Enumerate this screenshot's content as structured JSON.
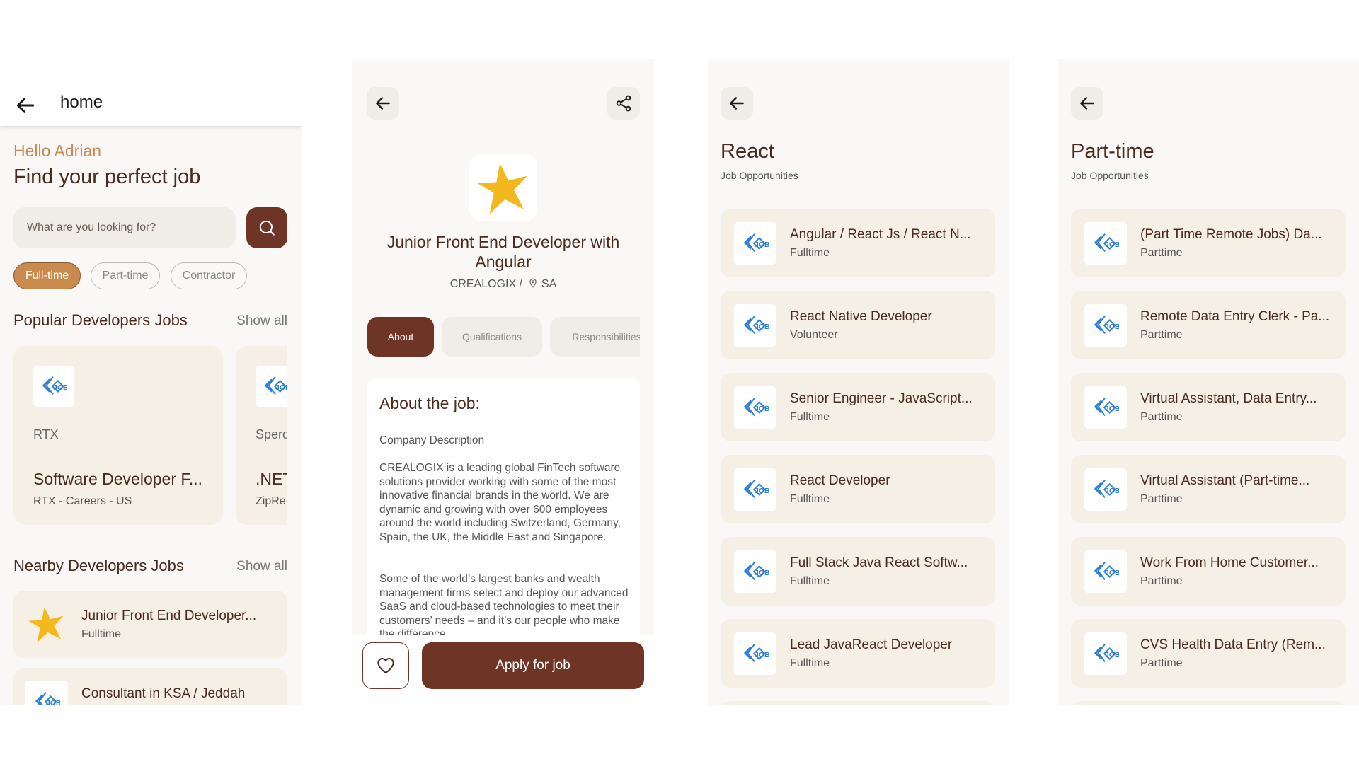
{
  "screen_home": {
    "appbar_title": "home",
    "greeting": "Hello Adrian",
    "headline": "Find your perfect job",
    "search_placeholder": "What are you looking for?",
    "chips": [
      "Full-time",
      "Part-time",
      "Contractor"
    ],
    "popular": {
      "heading": "Popular Developers Jobs",
      "show_all": "Show all",
      "cards": [
        {
          "company": "RTX",
          "title": "Software Developer F...",
          "subtitle": "RTX - Careers - US"
        },
        {
          "company": "Sperc",
          "title": ".NET",
          "subtitle": "ZipRe"
        }
      ]
    },
    "nearby": {
      "heading": "Nearby Developers Jobs",
      "show_all": "Show all",
      "items": [
        {
          "title": "Junior Front End Developer...",
          "type": "Fulltime"
        },
        {
          "title": "Consultant in KSA / Jeddah",
          "type": ""
        }
      ]
    }
  },
  "screen_detail": {
    "job_title": "Junior Front End Developer with Angular",
    "company": "CREALOGIX /",
    "location": "SA",
    "tabs": [
      "About",
      "Qualifications",
      "Responsibilities"
    ],
    "about_heading": "About the job:",
    "paragraphs": [
      "Company Description",
      "CREALOGIX is a leading global FinTech software solutions provider working with some of the most innovative financial brands in the world. We are dynamic and growing with over 600 employees around the world including Switzerland, Germany, Spain, the UK, the Middle East and Singapore.",
      "Some of the world’s largest banks and wealth management firms select and deploy our advanced SaaS and cloud-based technologies to meet their customers’ needs – and it’s our people who make the difference."
    ],
    "apply_label": "Apply for job"
  },
  "screen_react": {
    "heading": "React",
    "subheading": "Job Opportunities",
    "jobs": [
      {
        "title": "Angular / React Js / React N...",
        "type": "Fulltime"
      },
      {
        "title": "React Native Developer",
        "type": "Volunteer"
      },
      {
        "title": "Senior Engineer - JavaScript...",
        "type": "Fulltime"
      },
      {
        "title": "React Developer",
        "type": "Fulltime"
      },
      {
        "title": "Full Stack Java React Softw...",
        "type": "Fulltime"
      },
      {
        "title": "Lead JavaReact Developer",
        "type": "Fulltime"
      }
    ]
  },
  "screen_parttime": {
    "heading": "Part-time",
    "subheading": "Job Opportunities",
    "jobs": [
      {
        "title": "(Part Time Remote Jobs) Da...",
        "type": "Parttime"
      },
      {
        "title": "Remote Data Entry Clerk - Pa...",
        "type": "Parttime"
      },
      {
        "title": "Virtual Assistant, Data Entry...",
        "type": "Parttime"
      },
      {
        "title": "Virtual Assistant (Part-time...",
        "type": "Parttime"
      },
      {
        "title": "Work From Home Customer...",
        "type": "Parttime"
      },
      {
        "title": "CVS Health Data Entry (Rem...",
        "type": "Parttime"
      }
    ]
  },
  "colors": {
    "primary": "#6e3426",
    "accent": "#c98a4e",
    "card": "#f6efe6",
    "logo_blue": "#2f7fd6",
    "star": "#f2b81e"
  },
  "icons": [
    "back-arrow-icon",
    "share-icon",
    "search-icon",
    "heart-icon",
    "job-logo-icon",
    "star-logo-icon",
    "location-pin-icon"
  ]
}
